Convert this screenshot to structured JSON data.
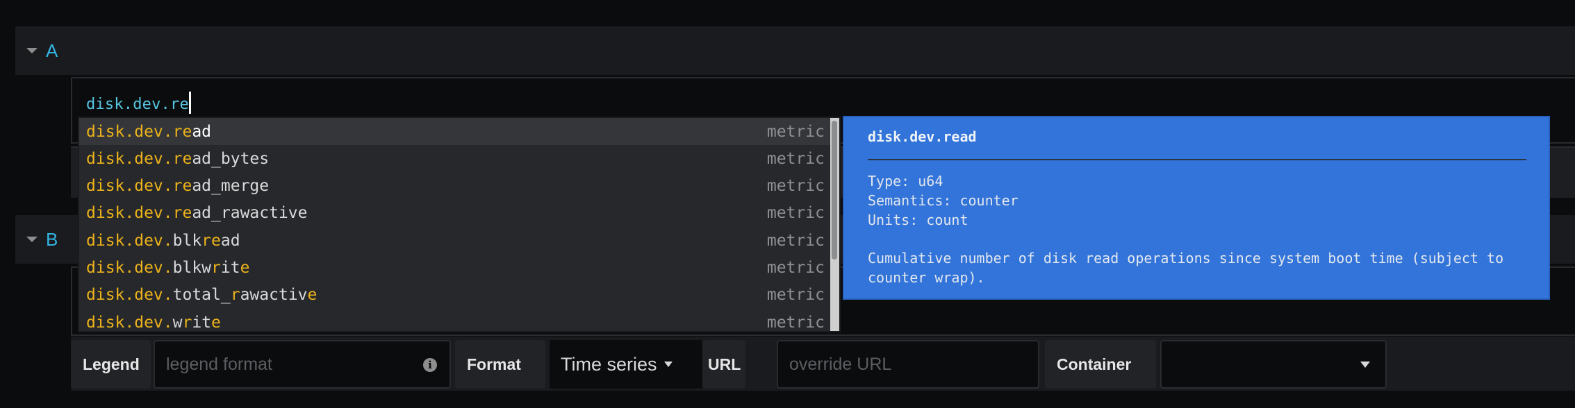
{
  "queries": [
    {
      "letter": "A"
    },
    {
      "letter": "B"
    }
  ],
  "editor": {
    "value": "disk.dev.re"
  },
  "suggestions": [
    {
      "parts": [
        [
          "disk.dev.re",
          true
        ],
        [
          "ad",
          false
        ]
      ],
      "kind": "metric",
      "selected": true
    },
    {
      "parts": [
        [
          "disk.dev.re",
          true
        ],
        [
          "ad_bytes",
          false
        ]
      ],
      "kind": "metric",
      "selected": false
    },
    {
      "parts": [
        [
          "disk.dev.re",
          true
        ],
        [
          "ad_merge",
          false
        ]
      ],
      "kind": "metric",
      "selected": false
    },
    {
      "parts": [
        [
          "disk.dev.re",
          true
        ],
        [
          "ad_rawactive",
          false
        ]
      ],
      "kind": "metric",
      "selected": false
    },
    {
      "parts": [
        [
          "disk.dev.",
          true
        ],
        [
          "blk",
          false
        ],
        [
          "re",
          true
        ],
        [
          "ad",
          false
        ]
      ],
      "kind": "metric",
      "selected": false
    },
    {
      "parts": [
        [
          "disk.dev.",
          true
        ],
        [
          "blkw",
          false
        ],
        [
          "r",
          true
        ],
        [
          "it",
          false
        ],
        [
          "e",
          true
        ]
      ],
      "kind": "metric",
      "selected": false
    },
    {
      "parts": [
        [
          "disk.dev.",
          true
        ],
        [
          "total_",
          false
        ],
        [
          "r",
          true
        ],
        [
          "awactiv",
          false
        ],
        [
          "e",
          true
        ]
      ],
      "kind": "metric",
      "selected": false
    },
    {
      "parts": [
        [
          "disk.dev.",
          true
        ],
        [
          "w",
          false
        ],
        [
          "r",
          true
        ],
        [
          "it",
          false
        ],
        [
          "e",
          true
        ]
      ],
      "kind": "metric",
      "selected": false
    }
  ],
  "doc": {
    "title": "disk.dev.read",
    "type": "Type: u64",
    "semantics": "Semantics: counter",
    "units": "Units: count",
    "description": "Cumulative number of disk read operations since system boot time (subject to counter wrap)."
  },
  "toolbar": {
    "legend_label": "Legend",
    "legend_placeholder": "legend format",
    "format_label": "Format",
    "format_value": "Time series",
    "url_label": "URL",
    "url_placeholder": "override URL",
    "container_label": "Container",
    "container_value": ""
  },
  "colors": {
    "accent": "#33b5e5",
    "match_highlight": "#ebb21b",
    "doc_background": "#3274d9",
    "query_text": "#56c6e0"
  }
}
